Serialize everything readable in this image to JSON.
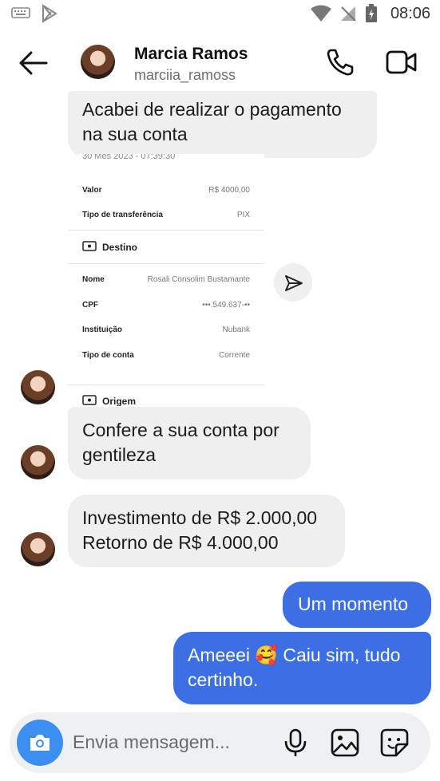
{
  "status_bar": {
    "time": "08:06"
  },
  "header": {
    "name": "Marcia Ramos",
    "username": "marciia_ramoss"
  },
  "messages": {
    "m1": "Acabei de realizar o pagamento na sua conta",
    "m2": "Confere a sua conta por gentileza",
    "m3_line1": "Investimento de R$ 2.000,00",
    "m3_line2": "Retorno de R$ 4.000,00",
    "m4": "Um momento",
    "m5": "Ameeei 🥰 Caiu sim, tudo certinho."
  },
  "receipt": {
    "date": "30 Mes 2023 - 07:39:30",
    "rows_top": [
      {
        "label": "Valor",
        "value": "R$ 4000,00"
      },
      {
        "label": "Tipo de transferência",
        "value": "PIX"
      }
    ],
    "section_destino": "Destino",
    "rows_destino": [
      {
        "label": "Nome",
        "value": "Rosali Consolim Bustamante"
      },
      {
        "label": "CPF",
        "value": "•••.549.637-••"
      },
      {
        "label": "Instituição",
        "value": "Nubank"
      },
      {
        "label": "Tipo de conta",
        "value": "Corrente"
      }
    ],
    "section_origem": "Origem"
  },
  "composer": {
    "placeholder": "Envia mensagem..."
  },
  "colors": {
    "sent_bubble": "#3b6fe3",
    "received_bubble": "#efefef",
    "camera": "#3c8ef0"
  }
}
